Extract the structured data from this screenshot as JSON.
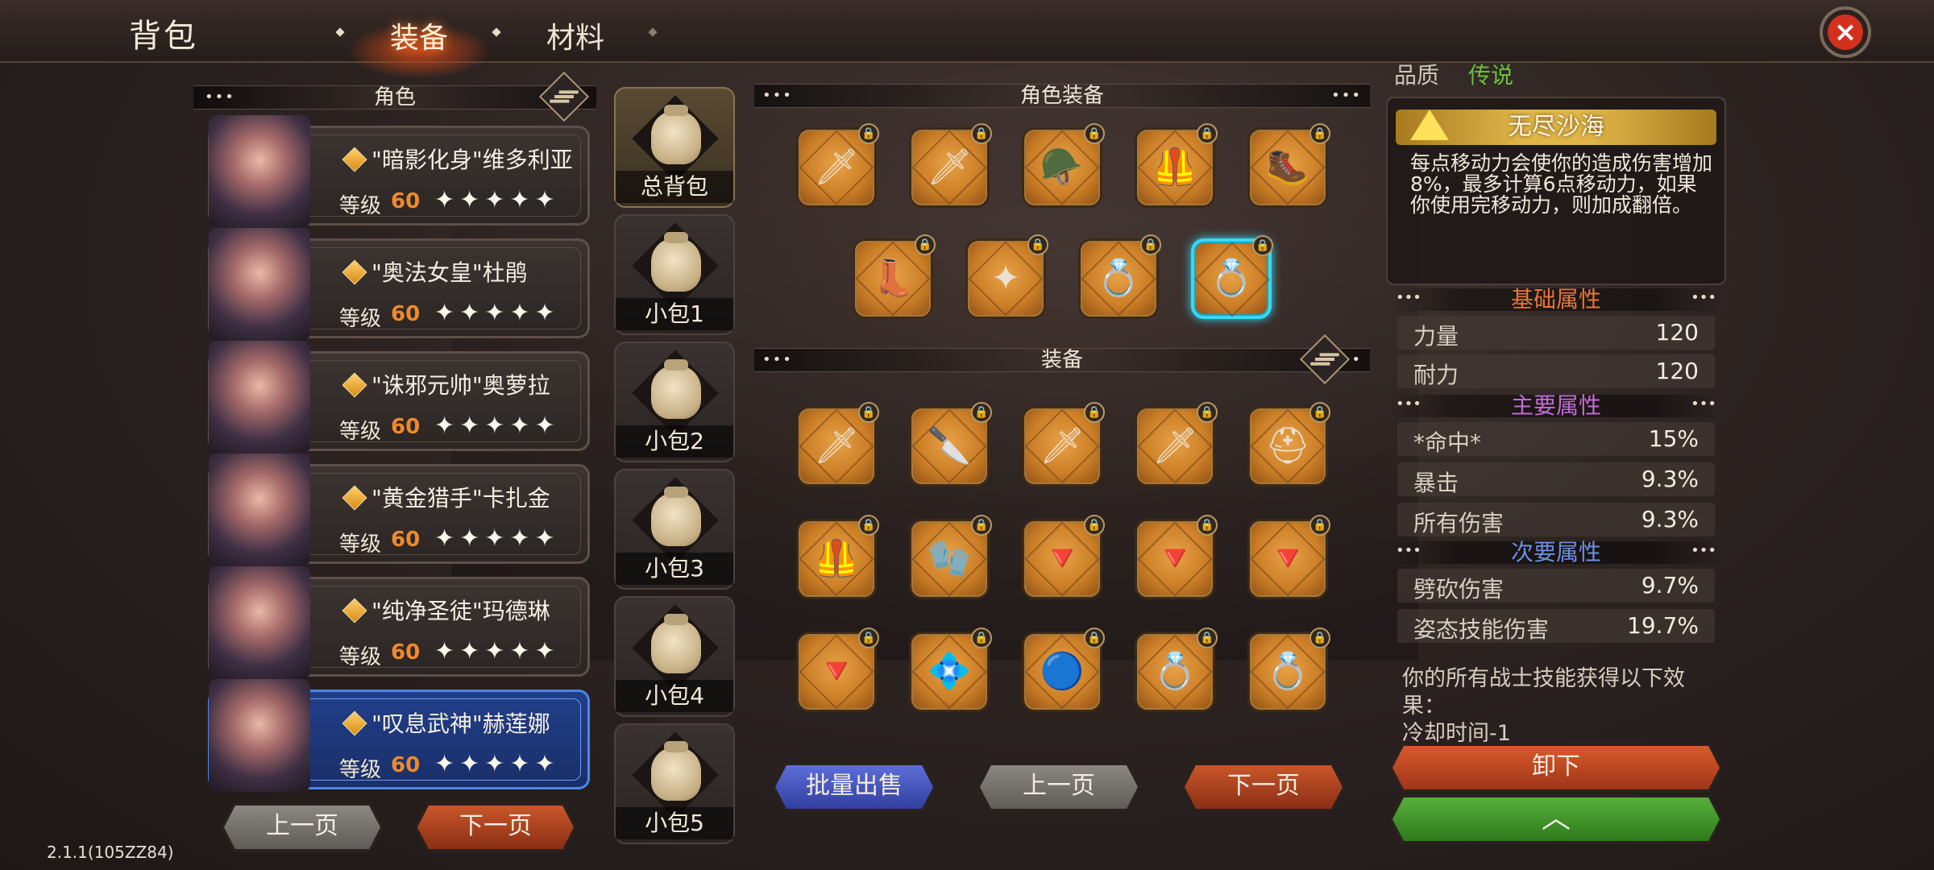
{
  "header": {
    "title": "背包",
    "tabs": [
      {
        "label": "装备",
        "active": true
      },
      {
        "label": "材料",
        "active": false
      }
    ]
  },
  "left_panel": {
    "title": "角色",
    "characters": [
      {
        "name": "\"暗影化身\"维多利亚",
        "level_label": "等级",
        "level": "60",
        "stars": "✦✦✦✦✦",
        "selected": false
      },
      {
        "name": "\"奥法女皇\"杜鹃",
        "level_label": "等级",
        "level": "60",
        "stars": "✦✦✦✦✦",
        "selected": false
      },
      {
        "name": "\"诛邪元帅\"奥萝拉",
        "level_label": "等级",
        "level": "60",
        "stars": "✦✦✦✦✦",
        "selected": false
      },
      {
        "name": "\"黄金猎手\"卡扎金",
        "level_label": "等级",
        "level": "60",
        "stars": "✦✦✦✦✦",
        "selected": false
      },
      {
        "name": "\"纯净圣徒\"玛德琳",
        "level_label": "等级",
        "level": "60",
        "stars": "✦✦✦✦✦",
        "selected": false
      },
      {
        "name": "\"叹息武神\"赫莲娜",
        "level_label": "等级",
        "level": "60",
        "stars": "✦✦✦✦✦",
        "selected": true
      }
    ],
    "prev_page": "上一页",
    "next_page": "下一页"
  },
  "bags": [
    {
      "label": "总背包",
      "active": true
    },
    {
      "label": "小包1",
      "active": false
    },
    {
      "label": "小包2",
      "active": false
    },
    {
      "label": "小包3",
      "active": false
    },
    {
      "label": "小包4",
      "active": false
    },
    {
      "label": "小包5",
      "active": false
    }
  ],
  "character_equipment": {
    "title": "角色装备",
    "slots": [
      {
        "icon": "dark-sword-icon",
        "glyph": "🗡"
      },
      {
        "icon": "red-blade-icon",
        "glyph": "🗡"
      },
      {
        "icon": "hood-icon",
        "glyph": "🪖"
      },
      {
        "icon": "chest-armor-icon",
        "glyph": "🦺"
      },
      {
        "icon": "leg-armor-icon",
        "glyph": "🥾"
      },
      {
        "icon": "boots-icon",
        "glyph": "👢"
      },
      {
        "icon": "winged-amulet-icon",
        "glyph": "✦"
      },
      {
        "icon": "ring-icon",
        "glyph": "💍"
      },
      {
        "icon": "ring-icon",
        "glyph": "💍",
        "selected": true
      }
    ]
  },
  "equipment": {
    "title": "装备",
    "items": [
      {
        "icon": "red-blade-icon",
        "glyph": "🗡"
      },
      {
        "icon": "cleaver-icon",
        "glyph": "🔪"
      },
      {
        "icon": "dark-sword-icon",
        "glyph": "🗡"
      },
      {
        "icon": "dark-sword-icon",
        "glyph": "🗡"
      },
      {
        "icon": "helmet-icon",
        "glyph": "⛑"
      },
      {
        "icon": "chest-armor-icon",
        "glyph": "🦺"
      },
      {
        "icon": "gauntlet-icon",
        "glyph": "🧤"
      },
      {
        "icon": "amulet-icon",
        "glyph": "🔻"
      },
      {
        "icon": "amulet-icon",
        "glyph": "🔻"
      },
      {
        "icon": "amulet-icon",
        "glyph": "🔻"
      },
      {
        "icon": "amulet-icon",
        "glyph": "🔻"
      },
      {
        "icon": "gem-necklace-icon",
        "glyph": "💠"
      },
      {
        "icon": "blue-orb-icon",
        "glyph": "🔵"
      },
      {
        "icon": "ring-icon",
        "glyph": "💍"
      },
      {
        "icon": "ring-icon",
        "glyph": "💍"
      }
    ],
    "bulk_sell": "批量出售",
    "prev_page": "上一页",
    "next_page": "下一页"
  },
  "detail": {
    "quality_label": "品质",
    "quality_value": "传说",
    "set_name": "无尽沙海",
    "set_description": "每点移动力会使你的造成伤害增加8%，最多计算6点移动力，如果你使用完移动力，则加成翻倍。",
    "base_title": "基础属性",
    "base_stats": [
      {
        "key": "力量",
        "value": "120"
      },
      {
        "key": "耐力",
        "value": "120"
      }
    ],
    "main_title": "主要属性",
    "main_stats": [
      {
        "key": "*命中*",
        "value": "15%"
      },
      {
        "key": "暴击",
        "value": "9.3%"
      },
      {
        "key": "所有伤害",
        "value": "9.3%"
      }
    ],
    "sub_title": "次要属性",
    "sub_stats": [
      {
        "key": "劈砍伤害",
        "value": "9.7%"
      },
      {
        "key": "姿态技能伤害",
        "value": "19.7%"
      }
    ],
    "skill_text": "你的所有战士技能获得以下效果：",
    "skill_effect": "冷却时间-1",
    "unequip": "卸下",
    "upgrade_icon": "chevron-up-icon"
  },
  "version": "2.1.1(105ZZ84)",
  "colors": {
    "accent": "#f08a2a",
    "selected_border": "#36d9f2",
    "quality": "#6ac03a"
  }
}
